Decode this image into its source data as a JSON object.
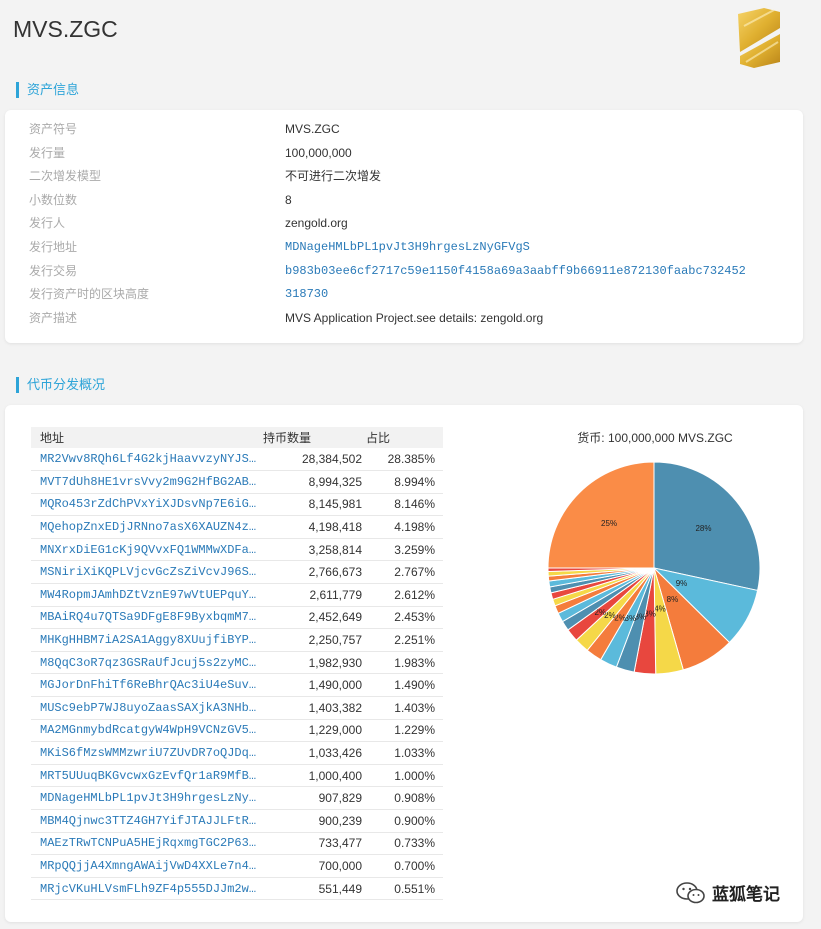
{
  "page": {
    "title": "MVS.ZGC"
  },
  "sections": {
    "info_title": "资产信息",
    "dist_title": "代币分发概况"
  },
  "info": [
    {
      "label": "资产符号",
      "value": "MVS.ZGC",
      "link": false
    },
    {
      "label": "发行量",
      "value": "100,000,000",
      "link": false
    },
    {
      "label": "二次增发模型",
      "value": "不可进行二次增发",
      "link": false
    },
    {
      "label": "小数位数",
      "value": "8",
      "link": false
    },
    {
      "label": "发行人",
      "value": "zengold.org",
      "link": false
    },
    {
      "label": "发行地址",
      "value": "MDNageHMLbPL1pvJt3H9hrgesLzNyGFVgS",
      "link": true
    },
    {
      "label": "发行交易",
      "value": "b983b03ee6cf2717c59e1150f4158a69a3aabff9b66911e872130faabc732452",
      "link": true
    },
    {
      "label": "发行资产时的区块高度",
      "value": "318730",
      "link": true
    },
    {
      "label": "资产描述",
      "value": "MVS Application Project.see details: zengold.org",
      "link": false
    }
  ],
  "table": {
    "headers": {
      "address": "地址",
      "amount": "持币数量",
      "share": "占比"
    },
    "rows": [
      {
        "address": "MR2Vwv8RQh6Lf4G2kjHaavvzyNYJS…",
        "amount": "28,384,502",
        "share": "28.385%"
      },
      {
        "address": "MVT7dUh8HE1vrsVvy2m9G2HfBG2AB…",
        "amount": "8,994,325",
        "share": "8.994%"
      },
      {
        "address": "MQRo453rZdChPVxYiXJDsvNp7E6iG…",
        "amount": "8,145,981",
        "share": "8.146%"
      },
      {
        "address": "MQehopZnxEDjJRNno7asX6XAUZN4z…",
        "amount": "4,198,418",
        "share": "4.198%"
      },
      {
        "address": "MNXrxDiEG1cKj9QVvxFQ1WMMwXDFa…",
        "amount": "3,258,814",
        "share": "3.259%"
      },
      {
        "address": "MSNiriXiKQPLVjcvGcZsZiVcvJ96S…",
        "amount": "2,766,673",
        "share": "2.767%"
      },
      {
        "address": "MW4RopmJAmhDZtVznE97wVtUEPquY…",
        "amount": "2,611,779",
        "share": "2.612%"
      },
      {
        "address": "MBAiRQ4u7QTSa9DFgE8F9ByxbqmM7…",
        "amount": "2,452,649",
        "share": "2.453%"
      },
      {
        "address": "MHKgHHBM7iA2SA1Aggy8XUujfiBYP…",
        "amount": "2,250,757",
        "share": "2.251%"
      },
      {
        "address": "M8QqC3oR7qz3GSRaUfJcuj5s2zyMC…",
        "amount": "1,982,930",
        "share": "1.983%"
      },
      {
        "address": "MGJorDnFhiTf6ReBhrQAc3iU4eSuv…",
        "amount": "1,490,000",
        "share": "1.490%"
      },
      {
        "address": "MUSc9ebP7WJ8uyoZaasSAXjkA3NHb…",
        "amount": "1,403,382",
        "share": "1.403%"
      },
      {
        "address": "MA2MGnmybdRcatgyW4WpH9VCNzGV5…",
        "amount": "1,229,000",
        "share": "1.229%"
      },
      {
        "address": "MKiS6fMzsWMMzwriU7ZUvDR7oQJDq…",
        "amount": "1,033,426",
        "share": "1.033%"
      },
      {
        "address": "MRT5UUuqBKGvcwxGzEvfQr1aR9MfB…",
        "amount": "1,000,400",
        "share": "1.000%"
      },
      {
        "address": "MDNageHMLbPL1pvJt3H9hrgesLzNy…",
        "amount": "907,829",
        "share": "0.908%"
      },
      {
        "address": "MBM4Qjnwc3TTZ4GH7YifJTAJJLFtR…",
        "amount": "900,239",
        "share": "0.900%"
      },
      {
        "address": "MAEzTRwTCNPuA5HEjRqxmgTGC2P63…",
        "amount": "733,477",
        "share": "0.733%"
      },
      {
        "address": "MRpQQjjA4XmngAWAijVwD4XXLe7n4…",
        "amount": "700,000",
        "share": "0.700%"
      },
      {
        "address": "MRjcVKuHLVsmFLh9ZF4p555DJJm2w…",
        "amount": "551,449",
        "share": "0.551%"
      }
    ]
  },
  "chart_data": {
    "type": "pie",
    "title": "货币: 100,000,000 MVS.ZGC",
    "slices": [
      {
        "value": 28.385,
        "label": "28%",
        "color": "#4e8fb0"
      },
      {
        "value": 8.994,
        "label": "9%",
        "color": "#5bbadb"
      },
      {
        "value": 8.146,
        "label": "8%",
        "color": "#f47c3c"
      },
      {
        "value": 4.198,
        "label": "4%",
        "color": "#f5d848"
      },
      {
        "value": 3.259,
        "label": "3%",
        "color": "#e8473e"
      },
      {
        "value": 2.767,
        "label": "3%",
        "color": "#4e8fb0"
      },
      {
        "value": 2.612,
        "label": "3%",
        "color": "#5bbadb"
      },
      {
        "value": 2.453,
        "label": "2%",
        "color": "#f47c3c"
      },
      {
        "value": 2.251,
        "label": "2%",
        "color": "#f5d848"
      },
      {
        "value": 1.983,
        "label": "2%",
        "color": "#e8473e"
      },
      {
        "value": 1.49,
        "label": "",
        "color": "#4e8fb0"
      },
      {
        "value": 1.403,
        "label": "",
        "color": "#5bbadb"
      },
      {
        "value": 1.229,
        "label": "",
        "color": "#f47c3c"
      },
      {
        "value": 1.033,
        "label": "",
        "color": "#f5d848"
      },
      {
        "value": 1.0,
        "label": "",
        "color": "#e8473e"
      },
      {
        "value": 0.908,
        "label": "",
        "color": "#4e8fb0"
      },
      {
        "value": 0.9,
        "label": "",
        "color": "#5bbadb"
      },
      {
        "value": 0.733,
        "label": "",
        "color": "#f47c3c"
      },
      {
        "value": 0.7,
        "label": "",
        "color": "#f5d848"
      },
      {
        "value": 0.551,
        "label": "",
        "color": "#e8473e"
      },
      {
        "value": 24.966,
        "label": "25%",
        "color": "#fa8c47"
      }
    ]
  },
  "watermark": {
    "text": "蓝狐笔记",
    "icon": "wechat-icon"
  },
  "logo": {
    "icon": "zengold-logo-icon",
    "color": "#e0b030"
  }
}
